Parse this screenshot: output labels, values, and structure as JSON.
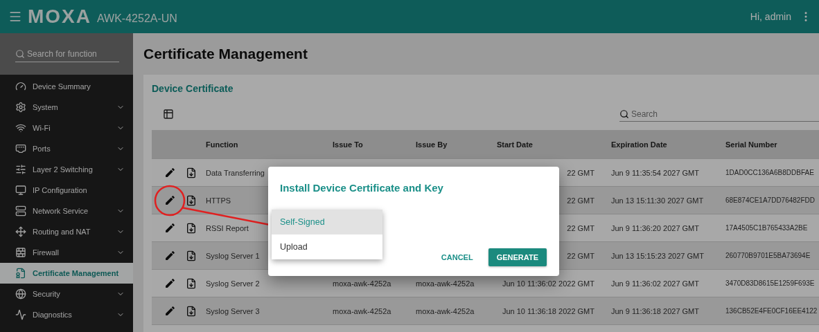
{
  "header": {
    "logo": "MOXA",
    "model": "AWK-4252A-UN",
    "greeting": "Hi, admin"
  },
  "sidebar": {
    "search": {
      "placeholder": "Search for function"
    },
    "items": [
      {
        "label": "Device Summary",
        "has_submenu": false,
        "selected": false
      },
      {
        "label": "System",
        "has_submenu": true,
        "selected": false
      },
      {
        "label": "Wi-Fi",
        "has_submenu": true,
        "selected": false
      },
      {
        "label": "Ports",
        "has_submenu": true,
        "selected": false
      },
      {
        "label": "Layer 2 Switching",
        "has_submenu": true,
        "selected": false
      },
      {
        "label": "IP Configuration",
        "has_submenu": false,
        "selected": false
      },
      {
        "label": "Network Service",
        "has_submenu": true,
        "selected": false
      },
      {
        "label": "Routing and NAT",
        "has_submenu": true,
        "selected": false
      },
      {
        "label": "Firewall",
        "has_submenu": true,
        "selected": false
      },
      {
        "label": "Certificate Management",
        "has_submenu": false,
        "selected": true
      },
      {
        "label": "Security",
        "has_submenu": true,
        "selected": false
      },
      {
        "label": "Diagnostics",
        "has_submenu": true,
        "selected": false
      }
    ]
  },
  "page_title": "Certificate Management",
  "card": {
    "title": "Device Certificate",
    "search": {
      "placeholder": "Search"
    },
    "table": {
      "columns": [
        "Function",
        "Issue To",
        "Issue By",
        "Start Date",
        "Expiration Date",
        "Serial Number"
      ],
      "rows": [
        {
          "function": "Data Transferring",
          "start_date": "22 GMT",
          "expiration_date": "Jun 9 11:35:54 2027 GMT",
          "serial_number": "1DAD0CC136A6B8DDBFAE"
        },
        {
          "function": "HTTPS",
          "start_date": "22 GMT",
          "expiration_date": "Jun 13 15:11:30 2027 GMT",
          "serial_number": "68E874CE1A7DD76482FDD"
        },
        {
          "function": "RSSI Report",
          "start_date": "22 GMT",
          "expiration_date": "Jun 9 11:36:20 2027 GMT",
          "serial_number": "17A4505C1B765433A2BE"
        },
        {
          "function": "Syslog Server 1",
          "start_date": "22 GMT",
          "expiration_date": "Jun 13 15:15:23 2027 GMT",
          "serial_number": "260770B9701E5BA73694E"
        },
        {
          "function": "Syslog Server 2",
          "issue_to": "moxa-awk-4252a",
          "issue_by": "moxa-awk-4252a",
          "start_date": "Jun 10 11:36:02 2022 GMT",
          "expiration_date": "Jun 9 11:36:02 2027 GMT",
          "serial_number": "3470D83D8615E1259F693E"
        },
        {
          "function": "Syslog Server 3",
          "issue_to": "moxa-awk-4252a",
          "issue_by": "moxa-awk-4252a",
          "start_date": "Jun 10 11:36:18 2022 GMT",
          "expiration_date": "Jun 9 11:36:18 2027 GMT",
          "serial_number": "136CB52E4FE0CF16EE4122"
        }
      ]
    }
  },
  "dialog": {
    "title": "Install Device Certificate and Key",
    "method_options": [
      {
        "label": "Self-Signed",
        "selected": true
      },
      {
        "label": "Upload",
        "selected": false
      }
    ],
    "buttons": [
      {
        "label": "CANCEL",
        "kind": "text"
      },
      {
        "label": "GENERATE",
        "kind": "primary"
      }
    ]
  }
}
